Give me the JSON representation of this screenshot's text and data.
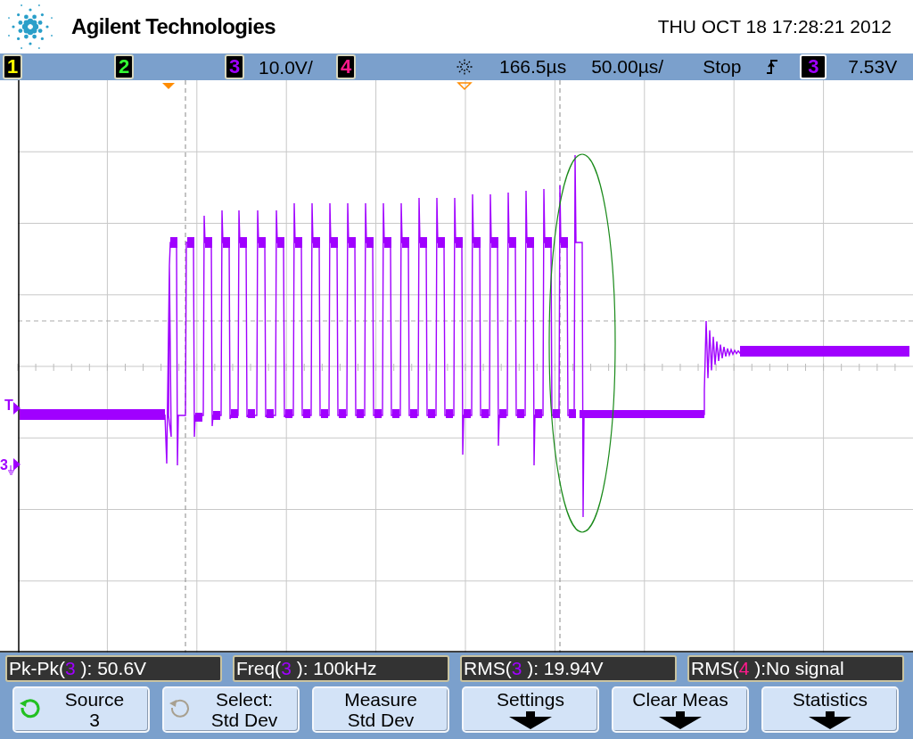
{
  "header": {
    "brand": "Agilent Technologies",
    "datetime": "THU OCT 18 17:28:21 2012"
  },
  "channels": [
    {
      "number": "1",
      "color": "#ffff00"
    },
    {
      "number": "2",
      "color": "#33ff33"
    },
    {
      "number": "3",
      "color": "#a000ff",
      "scale": "10.0V/"
    },
    {
      "number": "4",
      "color": "#ff1a8c"
    }
  ],
  "timebase": {
    "delay": "166.5µs",
    "scale": "50.00µs/"
  },
  "run_state": "Stop",
  "trigger": {
    "channel": "3",
    "color": "#a000ff",
    "level": "7.53V"
  },
  "markers": {
    "trigger": "T",
    "ground": "3"
  },
  "measurements": [
    {
      "label": "Pk-Pk(",
      "channel": "3",
      "color": "#a000ff",
      "value": " ): 50.6V"
    },
    {
      "label": "Freq(",
      "channel": "3",
      "color": "#a000ff",
      "value": " ): 100kHz"
    },
    {
      "label": "RMS(",
      "channel": "3",
      "color": "#a000ff",
      "value": " ): 19.94V"
    },
    {
      "label": "RMS(",
      "channel": "4",
      "color": "#ff1a8c",
      "value": " ):No signal"
    }
  ],
  "softkeys": [
    {
      "kind": "knob",
      "label": "Source",
      "value": "3",
      "active": true
    },
    {
      "kind": "knob",
      "label": "Select:",
      "value": "Std Dev",
      "active": false
    },
    {
      "kind": "plain",
      "label": "Measure",
      "value": "Std Dev"
    },
    {
      "kind": "submenu",
      "label": "Settings"
    },
    {
      "kind": "submenu",
      "label": "Clear Meas"
    },
    {
      "kind": "submenu",
      "label": "Statistics"
    }
  ]
}
